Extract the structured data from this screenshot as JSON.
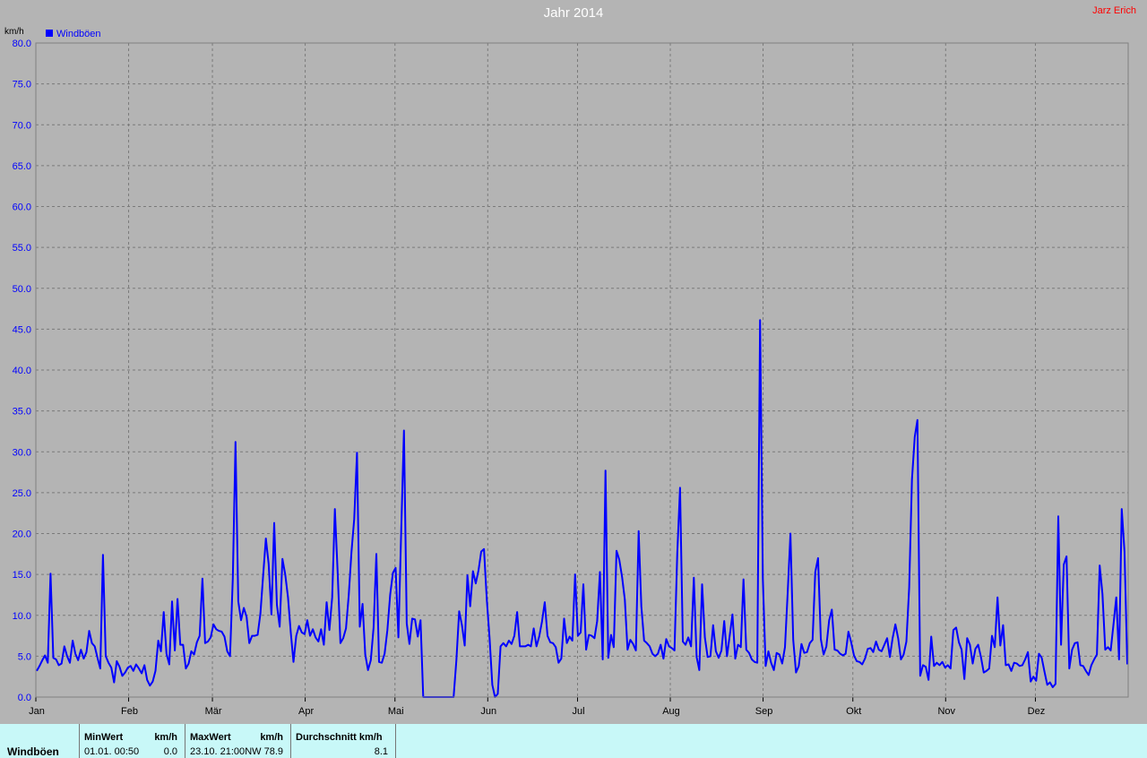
{
  "title": "Jahr 2014",
  "author": "Jarz Erich",
  "footer": {
    "row_label": "Windböen",
    "min_header": "MinWert",
    "min_unit": "km/h",
    "min_time": "01.01.  00:50",
    "min_value": "0.0",
    "max_header": "MaxWert",
    "max_unit": "km/h",
    "max_time": "23.10.  21:00",
    "max_value": "NW 78.9",
    "avg_header": "Durchschnitt km/h",
    "avg_value": "8.1"
  },
  "chart_data": {
    "type": "line",
    "ylabel": "km/h",
    "ylim": [
      0,
      80
    ],
    "yticks": [
      "0.0",
      "5.0",
      "10.0",
      "15.0",
      "20.0",
      "25.0",
      "30.0",
      "35.0",
      "40.0",
      "45.0",
      "50.0",
      "55.0",
      "60.0",
      "65.0",
      "70.0",
      "75.0",
      "80.0"
    ],
    "xticks": [
      "Jan",
      "Feb",
      "Mär",
      "Apr",
      "Mai",
      "Jun",
      "Jul",
      "Aug",
      "Sep",
      "Okt",
      "Nov",
      "Dez"
    ],
    "grid": true,
    "legend": "top-left",
    "line_color": "#0000ff",
    "series": [
      {
        "name": "Windböen",
        "values": [
          3.2,
          3.8,
          4.5,
          5.1,
          4.2,
          15.1,
          4.8,
          4.6,
          3.9,
          4.1,
          6.2,
          5.0,
          4.2,
          6.9,
          5.3,
          4.5,
          5.8,
          4.7,
          5.5,
          8.1,
          6.6,
          6.2,
          4.8,
          3.5,
          17.4,
          5.0,
          4.2,
          3.6,
          1.8,
          4.4,
          3.7,
          2.6,
          3.0,
          3.6,
          3.8,
          3.2,
          4.0,
          3.5,
          2.9,
          3.9,
          2.1,
          1.4,
          1.9,
          3.2,
          6.9,
          5.6,
          10.4,
          5.3,
          4.0,
          11.7,
          5.7,
          12.0,
          6.4,
          6.4,
          3.5,
          4.1,
          5.6,
          5.2,
          6.7,
          7.5,
          14.5,
          6.6,
          6.8,
          7.3,
          8.9,
          8.3,
          8.1,
          8.0,
          7.4,
          5.6,
          5.0,
          14.5,
          31.2,
          11.7,
          9.4,
          10.9,
          9.8,
          6.6,
          7.5,
          7.5,
          7.6,
          10.2,
          14.8,
          19.4,
          16.3,
          10.1,
          21.3,
          11.3,
          8.6,
          16.9,
          15.0,
          12.2,
          7.9,
          4.3,
          7.5,
          8.7,
          7.9,
          7.7,
          9.4,
          7.5,
          8.3,
          7.3,
          6.8,
          8.3,
          6.4,
          11.6,
          8.2,
          12.2,
          23.0,
          15.3,
          6.6,
          7.2,
          8.4,
          12.5,
          17.7,
          21.8,
          29.9,
          8.6,
          11.4,
          5.2,
          3.3,
          4.5,
          8.5,
          17.5,
          4.3,
          4.2,
          5.3,
          8.2,
          12.5,
          15.2,
          15.8,
          7.3,
          20.2,
          32.6,
          9.0,
          6.5,
          9.6,
          9.5,
          7.4,
          9.4,
          0.0,
          0.0,
          0.0,
          0.0,
          0.0,
          0.0,
          0.0,
          0.0,
          0.0,
          0.0,
          0.0,
          0.0,
          4.5,
          10.5,
          8.8,
          6.3,
          14.9,
          11.1,
          15.4,
          13.9,
          15.5,
          17.8,
          18.1,
          12.0,
          7.3,
          1.5,
          0.0,
          0.4,
          6.2,
          6.6,
          6.2,
          6.9,
          6.5,
          7.5,
          10.4,
          6.2,
          6.2,
          6.2,
          6.4,
          6.2,
          8.4,
          6.2,
          7.4,
          9.2,
          11.6,
          7.5,
          6.7,
          6.6,
          6.1,
          4.2,
          4.7,
          9.6,
          6.6,
          7.4,
          6.9,
          15.0,
          7.5,
          7.9,
          13.8,
          5.8,
          7.6,
          7.5,
          7.2,
          9.3,
          15.3,
          4.6,
          27.7,
          4.8,
          7.6,
          6.1,
          17.9,
          16.8,
          14.7,
          11.9,
          5.8,
          7.0,
          6.5,
          5.7,
          20.3,
          11.1,
          6.9,
          6.6,
          6.2,
          5.3,
          5.0,
          5.3,
          6.4,
          4.7,
          7.1,
          6.2,
          6.0,
          5.7,
          17.6,
          25.6,
          6.8,
          6.4,
          7.3,
          6.2,
          14.6,
          4.9,
          3.3,
          13.8,
          7.3,
          4.9,
          5.0,
          8.8,
          5.6,
          4.8,
          5.7,
          9.3,
          5.0,
          7.5,
          10.1,
          4.7,
          6.4,
          6.1,
          14.4,
          5.8,
          5.4,
          4.6,
          4.3,
          4.2,
          46.1,
          14.5,
          3.8,
          5.6,
          4.2,
          3.3,
          5.4,
          5.2,
          4.1,
          6.1,
          12.7,
          20.0,
          7.0,
          3.0,
          3.8,
          6.5,
          5.4,
          5.5,
          6.6,
          7.0,
          15.3,
          17.0,
          7.1,
          5.2,
          6.2,
          9.4,
          10.7,
          5.8,
          5.7,
          5.3,
          5.1,
          5.3,
          8.0,
          6.7,
          5.1,
          4.4,
          4.3,
          4.0,
          4.7,
          5.9,
          6.0,
          5.5,
          6.8,
          5.8,
          5.6,
          6.4,
          7.2,
          4.9,
          7.2,
          8.9,
          7.2,
          4.6,
          5.2,
          6.8,
          13.4,
          26.6,
          31.8,
          33.9,
          2.6,
          3.9,
          3.7,
          2.1,
          7.4,
          3.8,
          4.2,
          3.9,
          4.3,
          3.6,
          3.9,
          3.5,
          8.2,
          8.5,
          6.7,
          5.8,
          2.2,
          7.2,
          6.4,
          4.1,
          5.9,
          6.4,
          4.9,
          3.0,
          3.2,
          3.5,
          7.5,
          6.1,
          12.2,
          6.3,
          8.8,
          3.9,
          4.0,
          3.2,
          4.2,
          4.1,
          3.8,
          3.9,
          4.6,
          5.5,
          1.9,
          2.5,
          2.0,
          5.3,
          4.8,
          3.1,
          1.5,
          1.8,
          1.2,
          1.6,
          22.1,
          6.4,
          16.2,
          17.2,
          3.5,
          5.8,
          6.6,
          6.7,
          3.9,
          3.8,
          3.2,
          2.7,
          3.9,
          4.6,
          5.2,
          16.1,
          12.6,
          5.8,
          6.1,
          5.7,
          8.9,
          12.2,
          4.6,
          23.0,
          17.8,
          4.0
        ]
      }
    ]
  }
}
